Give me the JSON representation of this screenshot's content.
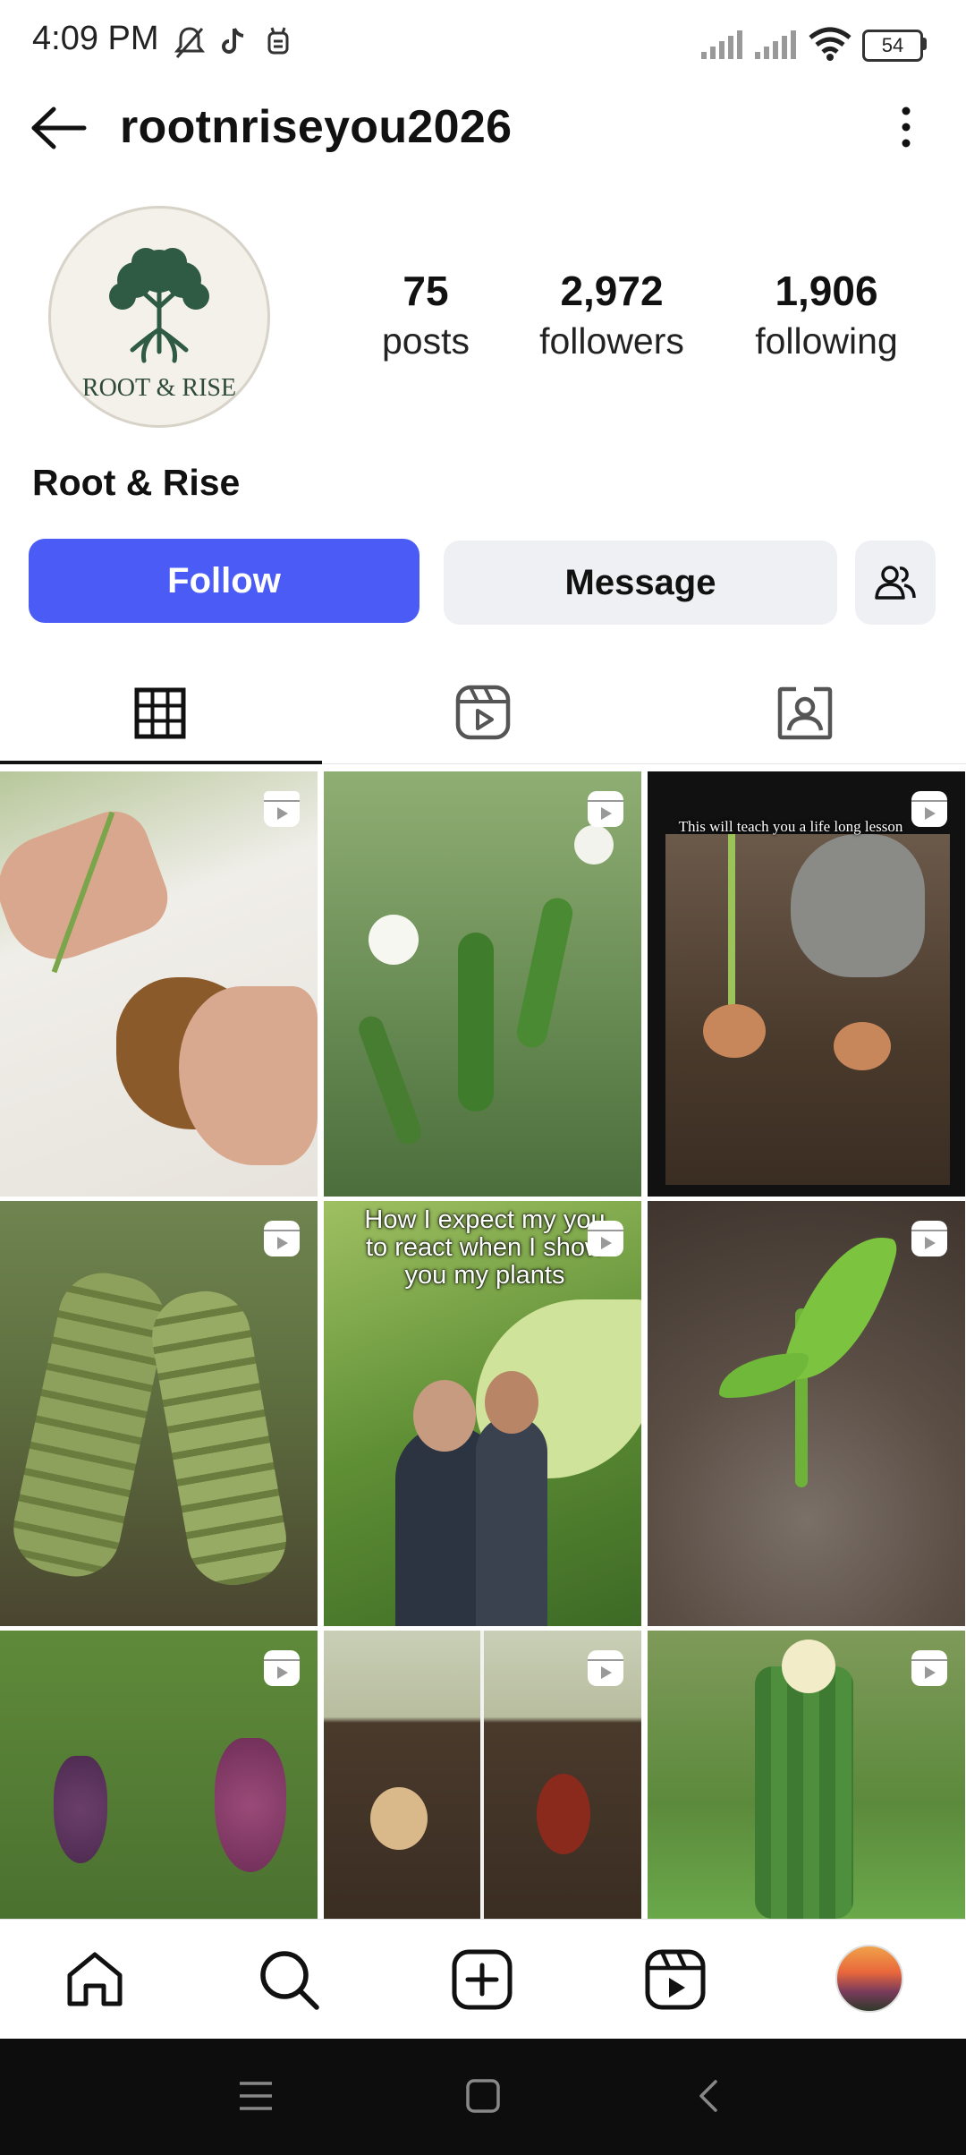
{
  "status_bar": {
    "time": "4:09 PM",
    "battery": "54",
    "icons": [
      "mute-icon",
      "tiktok-icon",
      "robot-icon",
      "signal-icon",
      "signal-icon",
      "wifi-icon",
      "battery-icon"
    ]
  },
  "header": {
    "username": "rootnriseyou2026",
    "back_icon": "arrow-left-icon",
    "menu_icon": "more-vertical-icon"
  },
  "profile": {
    "avatar_text": "ROOT & RISE",
    "name": "Root & Rise",
    "stats": [
      {
        "value": "75",
        "label": "posts"
      },
      {
        "value": "2,972",
        "label": "followers"
      },
      {
        "value": "1,906",
        "label": "following"
      }
    ]
  },
  "actions": {
    "follow_label": "Follow",
    "message_label": "Message",
    "suggested_icon": "add-people-icon"
  },
  "tabs": [
    {
      "name": "posts-grid",
      "icon": "grid-icon",
      "active": true
    },
    {
      "name": "reels",
      "icon": "reels-icon",
      "active": false
    },
    {
      "name": "tagged",
      "icon": "tagged-person-icon",
      "active": false
    }
  ],
  "posts": [
    {
      "subject": "hands holding plant with roots on rock",
      "caption": ""
    },
    {
      "subject": "green chili peppers with white flowers",
      "caption": ""
    },
    {
      "subject": "seedlings growing beside rock",
      "caption": "This will teach you a life long lesson"
    },
    {
      "subject": "plant with hanging green pods",
      "caption": ""
    },
    {
      "subject": "monstera leaves and people hugging",
      "caption": "How I expect my you to react when I show you my plants"
    },
    {
      "subject": "sprout emerging from wet soil",
      "caption": ""
    },
    {
      "subject": "grape vines with purple grapes",
      "caption": ""
    },
    {
      "subject": "seeds buried in soil",
      "caption": ""
    },
    {
      "subject": "dragon fruit cactus with flower",
      "caption": ""
    }
  ],
  "bottom_nav": [
    {
      "name": "home",
      "icon": "home-icon"
    },
    {
      "name": "search",
      "icon": "search-icon"
    },
    {
      "name": "create",
      "icon": "plus-square-icon"
    },
    {
      "name": "reels",
      "icon": "reels-icon"
    },
    {
      "name": "profile",
      "icon": "profile-avatar-icon"
    }
  ],
  "system_nav": [
    "menu-icon",
    "home-square-icon",
    "back-chevron-icon"
  ],
  "colors": {
    "follow_button": "#4a5cf5",
    "secondary_button": "#eef0f4",
    "text": "#111111"
  }
}
